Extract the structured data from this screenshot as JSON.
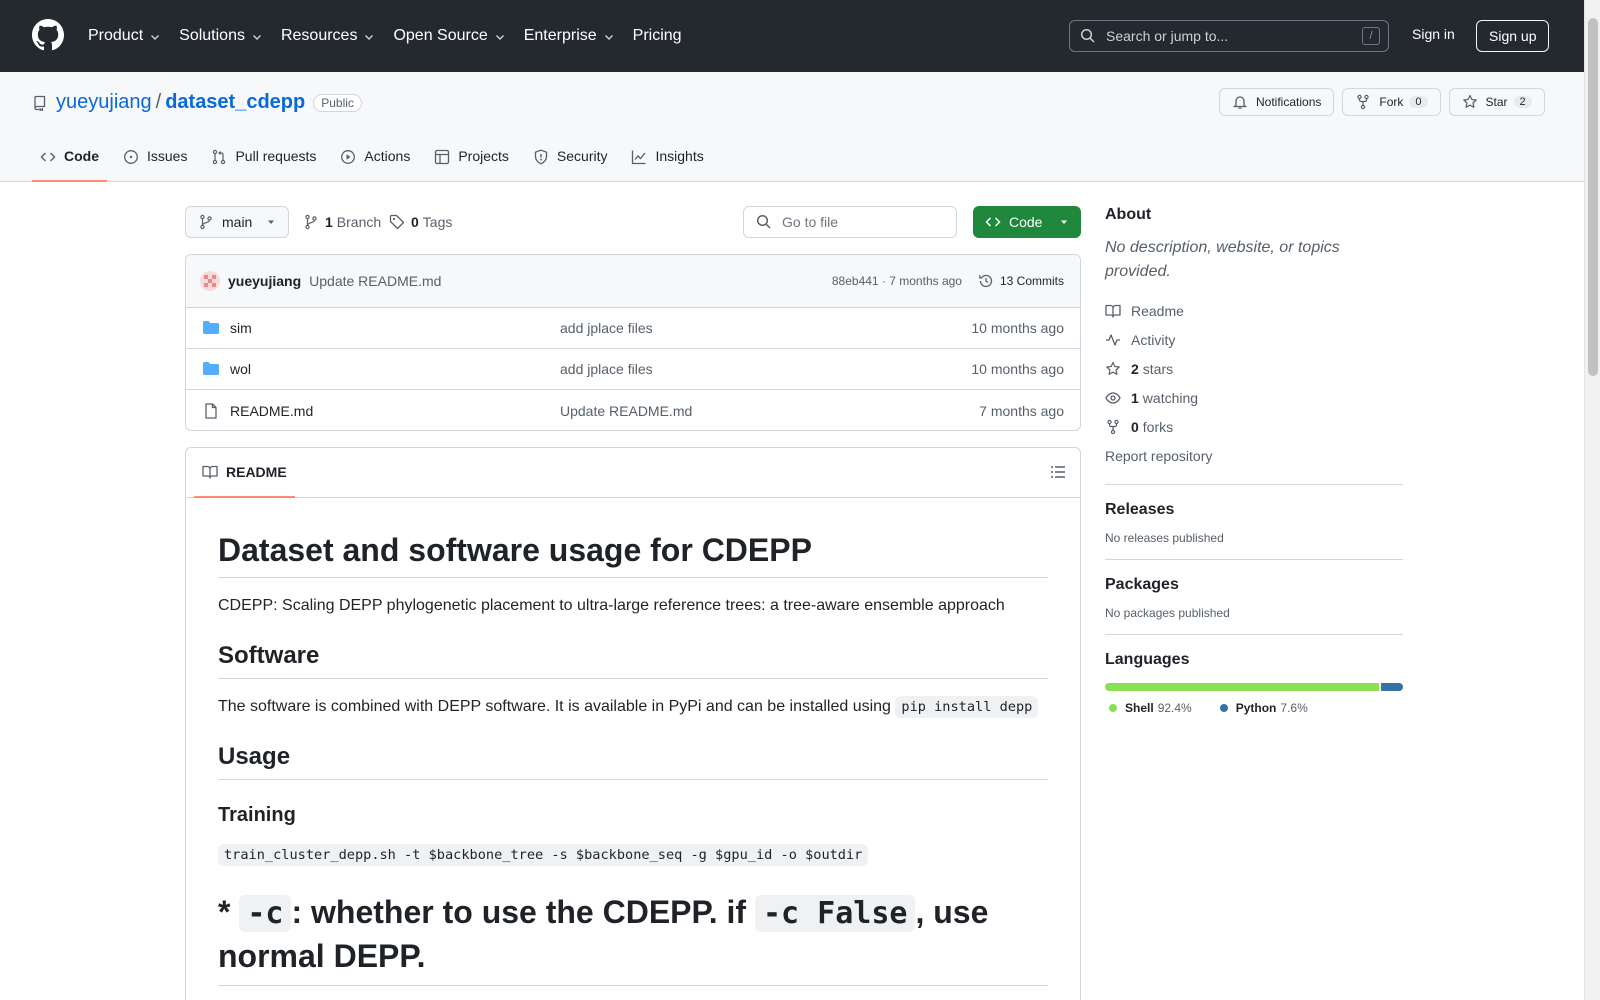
{
  "header": {
    "nav": [
      "Product",
      "Solutions",
      "Resources",
      "Open Source",
      "Enterprise",
      "Pricing"
    ],
    "search_placeholder": "Search or jump to...",
    "search_shortcut": "/",
    "sign_in": "Sign in",
    "sign_up": "Sign up"
  },
  "repo": {
    "owner": "yueyujiang",
    "separator": "/",
    "name": "dataset_cdepp",
    "visibility": "Public",
    "notifications_label": "Notifications",
    "fork_label": "Fork",
    "fork_count": "0",
    "star_label": "Star",
    "star_count": "2"
  },
  "tabs": [
    "Code",
    "Issues",
    "Pull requests",
    "Actions",
    "Projects",
    "Security",
    "Insights"
  ],
  "branch": {
    "current": "main",
    "branch_count": "1",
    "branch_label": "Branch",
    "tag_count": "0",
    "tag_label": "Tags",
    "go_to_file": "Go to file",
    "code_button": "Code"
  },
  "commit": {
    "user": "yueyujiang",
    "message": "Update README.md",
    "sha_time": "88eb441 · 7 months ago",
    "commits": "13 Commits"
  },
  "files": [
    {
      "name": "sim",
      "type": "folder",
      "message": "add jplace files",
      "age": "10 months ago"
    },
    {
      "name": "wol",
      "type": "folder",
      "message": "add jplace files",
      "age": "10 months ago"
    },
    {
      "name": "README.md",
      "type": "file",
      "message": "Update README.md",
      "age": "7 months ago"
    }
  ],
  "readme": {
    "tab": "README",
    "h1": "Dataset and software usage for CDEPP",
    "intro": "CDEPP: Scaling DEPP phylogenetic placement to ultra-large reference trees: a tree-aware ensemble approach",
    "h2_software": "Software",
    "software_text": "The software is combined with DEPP software. It is available in PyPi and can be installed using",
    "software_code": "pip install depp",
    "h2_usage": "Usage",
    "h3_training": "Training",
    "training_code": "train_cluster_depp.sh -t $backbone_tree -s $backbone_seq -g $gpu_id -o $outdir",
    "h1b_prefix": "* ",
    "h1b_code1": "-c",
    "h1b_mid": ": whether to use the CDEPP. if ",
    "h1b_code2": "-c False",
    "h1b_suffix": ", use normal DEPP."
  },
  "about": {
    "title": "About",
    "description": "No description, website, or topics provided.",
    "links": [
      {
        "icon": "book-icon",
        "bold": "",
        "text": "Readme"
      },
      {
        "icon": "pulse-icon",
        "bold": "",
        "text": "Activity"
      },
      {
        "icon": "star-icon",
        "bold": "2",
        "text": "stars"
      },
      {
        "icon": "eye-icon",
        "bold": "1",
        "text": "watching"
      },
      {
        "icon": "fork-icon",
        "bold": "0",
        "text": "forks"
      }
    ],
    "report": "Report repository"
  },
  "releases": {
    "title": "Releases",
    "text": "No releases published"
  },
  "packages": {
    "title": "Packages",
    "text": "No packages published"
  },
  "languages": {
    "title": "Languages",
    "items": [
      {
        "name": "Shell",
        "percent": 92.4,
        "percent_label": "92.4%",
        "color": "#89e051"
      },
      {
        "name": "Python",
        "percent": 7.6,
        "percent_label": "7.6%",
        "color": "#3572A5"
      }
    ]
  },
  "colors": {
    "accent": "#0969da",
    "green": "#1f883d",
    "tab_underline": "#fd8c73",
    "header_bg": "#24292f"
  }
}
